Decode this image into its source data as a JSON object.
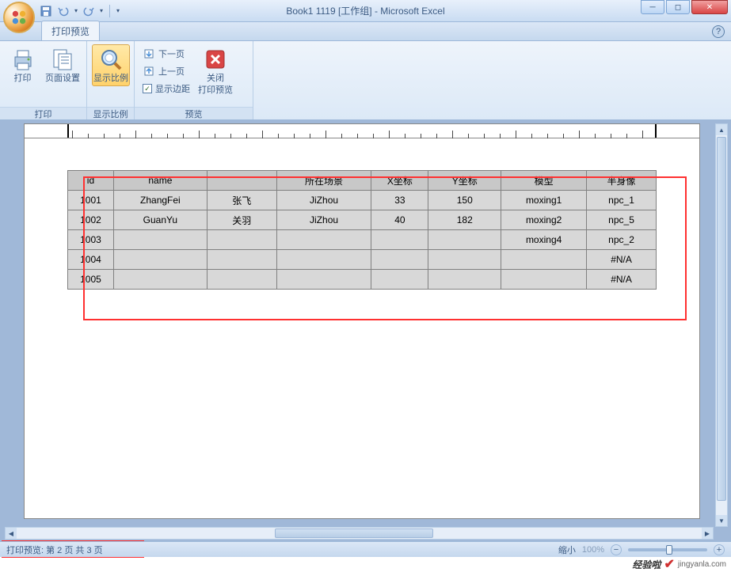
{
  "window": {
    "title": "Book1 1119  [工作组] - Microsoft Excel"
  },
  "tab": {
    "name": "打印预览"
  },
  "ribbon": {
    "groups": {
      "print": {
        "label": "打印",
        "print_btn": "打印",
        "page_setup_btn": "页面设置"
      },
      "zoom": {
        "label": "显示比例",
        "zoom_btn": "显示比例"
      },
      "preview": {
        "label": "预览",
        "next_page": "下一页",
        "prev_page": "上一页",
        "show_margins": "显示边距",
        "close_btn_l1": "关闭",
        "close_btn_l2": "打印预览"
      }
    }
  },
  "table": {
    "headers": [
      "id",
      "name",
      "",
      "所在场景",
      "X坐标",
      "Y坐标",
      "模型",
      "半身像"
    ],
    "rows": [
      [
        "1001",
        "ZhangFei",
        "张飞",
        "JiZhou",
        "33",
        "150",
        "moxing1",
        "npc_1"
      ],
      [
        "1002",
        "GuanYu",
        "关羽",
        "JiZhou",
        "40",
        "182",
        "moxing2",
        "npc_5"
      ],
      [
        "1003",
        "",
        "",
        "",
        "",
        "",
        "moxing4",
        "npc_2"
      ],
      [
        "1004",
        "",
        "",
        "",
        "",
        "",
        "",
        "#N/A"
      ],
      [
        "1005",
        "",
        "",
        "",
        "",
        "",
        "",
        "#N/A"
      ]
    ]
  },
  "status": {
    "page_info": "打印预览: 第 2 页  共 3 页",
    "zoom_label": "缩小",
    "zoom_pct": "100%"
  },
  "watermark": {
    "brand1": "经验啦",
    "check": "✔",
    "url": "jingyanla.com"
  }
}
